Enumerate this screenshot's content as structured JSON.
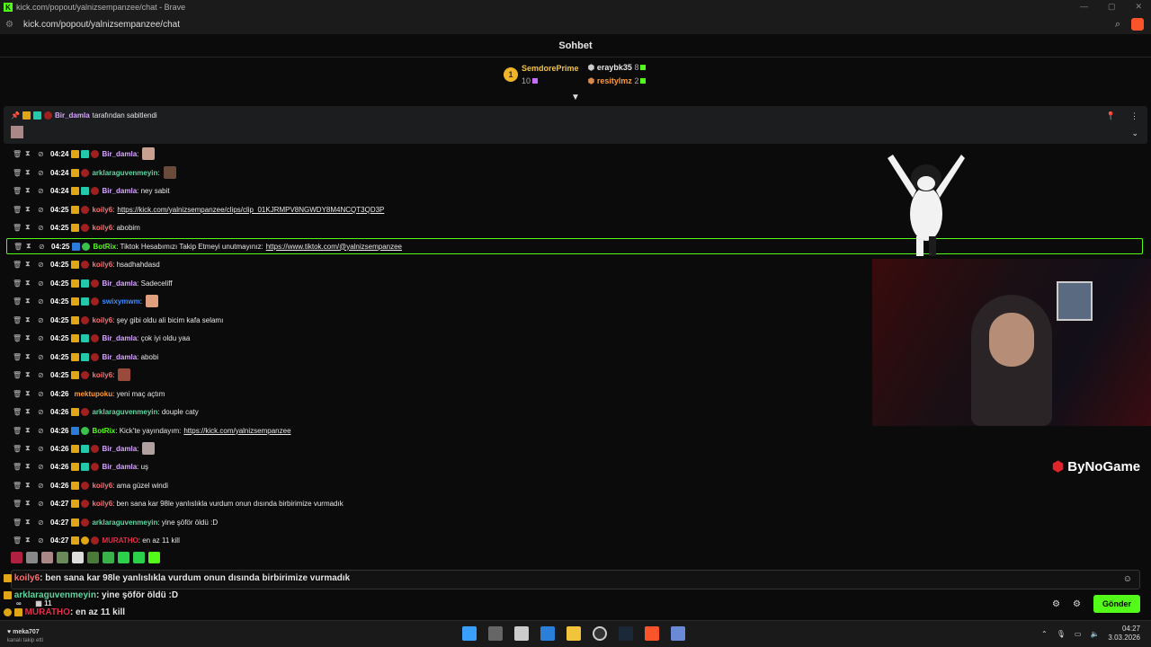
{
  "window": {
    "title": "kick.com/popout/yalnizsempanzee/chat - Brave",
    "url": "kick.com/popout/yalnizsempanzee/chat"
  },
  "chat": {
    "header": "Sohbet",
    "leaderboard": {
      "first": {
        "rank": "1",
        "name": "SemdorePrime",
        "count": "10"
      },
      "second": {
        "name": "eraybk35",
        "count": "8"
      },
      "third": {
        "name": "resitylmz",
        "count": "2"
      }
    },
    "pinned": {
      "user": "Bir_damla",
      "text": "tarafından sabitlendi"
    },
    "messages": [
      {
        "time": "04:24",
        "user": "Bir_damla",
        "color": "#d7a8ff",
        "text": ":",
        "emote": "#c8a090",
        "link": ""
      },
      {
        "time": "04:24",
        "user": "arklaraguvenmeyin",
        "color": "#5ed6a0",
        "text": ":",
        "emote": "#6a4a3a",
        "link": ""
      },
      {
        "time": "04:24",
        "user": "Bir_damla",
        "color": "#d7a8ff",
        "text": ": ney sabit",
        "emote": "",
        "link": ""
      },
      {
        "time": "04:25",
        "user": "koily6",
        "color": "#ff6f6f",
        "text": ":",
        "emote": "",
        "link": "https://kick.com/yalnizsempanzee/clips/clip_01KJRMPV8NGWDY8M4NCQT3QD3P"
      },
      {
        "time": "04:25",
        "user": "koily6",
        "color": "#ff6f6f",
        "text": ": abobim",
        "emote": "",
        "link": ""
      },
      {
        "time": "04:25",
        "user": "BotRix",
        "color": "#53fc18",
        "text": ": Tiktok Hesabımızı Takip Etmeyi unutmayınız:",
        "emote": "",
        "link": "https://www.tiktok.com/@yalnizsempanzee"
      },
      {
        "time": "04:25",
        "user": "koily6",
        "color": "#ff6f6f",
        "text": ": hsadhahdasd",
        "emote": "",
        "link": ""
      },
      {
        "time": "04:25",
        "user": "Bir_damla",
        "color": "#d7a8ff",
        "text": ":   Sadeceliff",
        "emote": "",
        "link": ""
      },
      {
        "time": "04:25",
        "user": "swixymwm",
        "color": "#3b8cff",
        "text": ":",
        "emote": "#e0a080",
        "link": ""
      },
      {
        "time": "04:25",
        "user": "koily6",
        "color": "#ff6f6f",
        "text": ": şey gibi oldu ali bicim kafa selamı",
        "emote": "",
        "link": ""
      },
      {
        "time": "04:25",
        "user": "Bir_damla",
        "color": "#d7a8ff",
        "text": ": çok iyi oldu yaa",
        "emote": "",
        "link": ""
      },
      {
        "time": "04:25",
        "user": "Bir_damla",
        "color": "#d7a8ff",
        "text": ": abobi",
        "emote": "",
        "link": ""
      },
      {
        "time": "04:25",
        "user": "koily6",
        "color": "#ff6f6f",
        "text": ":",
        "emote": "#9a4a3a",
        "link": ""
      },
      {
        "time": "04:26",
        "user": "mektupoku",
        "color": "#ff9a3c",
        "text": ": yeni maç açtım",
        "emote": "",
        "link": ""
      },
      {
        "time": "04:26",
        "user": "arklaraguvenmeyin",
        "color": "#5ed6a0",
        "text": ": douple caty",
        "emote": "",
        "link": ""
      },
      {
        "time": "04:26",
        "user": "BotRix",
        "color": "#53fc18",
        "text": ": Kick'te yayındayım:",
        "emote": "",
        "link": "https://kick.com/yalnizsempanzee"
      },
      {
        "time": "04:26",
        "user": "Bir_damla",
        "color": "#d7a8ff",
        "text": ":",
        "emote": "#b0a0a0",
        "link": ""
      },
      {
        "time": "04:26",
        "user": "Bir_damla",
        "color": "#d7a8ff",
        "text": ": uş",
        "emote": "",
        "link": ""
      },
      {
        "time": "04:26",
        "user": "koily6",
        "color": "#ff6f6f",
        "text": ": ama güzel windi",
        "emote": "",
        "link": ""
      },
      {
        "time": "04:27",
        "user": "koily6",
        "color": "#ff6f6f",
        "text": ": ben sana kar 98le yanlıslıkla vurdum onun dısında birbirimize vurmadık",
        "emote": "",
        "link": ""
      },
      {
        "time": "04:27",
        "user": "arklaraguvenmeyin",
        "color": "#5ed6a0",
        "text": ": yine şöför öldü :D",
        "emote": "",
        "link": ""
      },
      {
        "time": "04:27",
        "user": "MURATHO",
        "color": "#e0304a",
        "text": ": en az 11 kill",
        "emote": "",
        "link": ""
      }
    ],
    "overlay": [
      {
        "user": "koily6",
        "color": "#ff6f6f",
        "text": ": ben sana kar 98le yanlıslıkla vurdum onun dısında birbirimize vurmadık"
      },
      {
        "user": "arklaraguvenmeyin",
        "color": "#5ed6a0",
        "text": ": yine şöför öldü :D"
      },
      {
        "user": "MURATHO",
        "color": "#e0304a",
        "text": ": en az 11 kill"
      }
    ],
    "overlay_counts": {
      "loop": "∞",
      "calendar": "11"
    },
    "send_label": "Gönder"
  },
  "stream": {
    "sponsor": "ByNoGame"
  },
  "taskbar": {
    "user": "meka707",
    "user_sub": "kanalı takip etti",
    "time": "04:27",
    "date": "3.03.2026"
  },
  "colors": {
    "accent": "#53fc18",
    "background": "#0b0b0c"
  }
}
